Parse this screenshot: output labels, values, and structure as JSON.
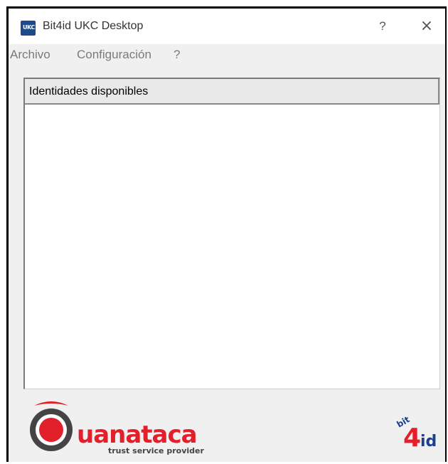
{
  "window": {
    "title": "Bit4id UKC Desktop",
    "app_icon_text": "UKC",
    "help_symbol": "?",
    "close_symbol": "×"
  },
  "menubar": {
    "items": [
      {
        "label": "Archivo"
      },
      {
        "label": "Configuración"
      },
      {
        "label": "?"
      }
    ]
  },
  "identities_list": {
    "header": "Identidades disponibles",
    "items": []
  },
  "footer": {
    "left_logo": {
      "name": "uanataca",
      "tagline": "trust service provider",
      "color": "#e2202c"
    },
    "right_logo": {
      "name": "bit4id",
      "color_red": "#e2202c",
      "color_blue": "#1b3f8a"
    }
  }
}
